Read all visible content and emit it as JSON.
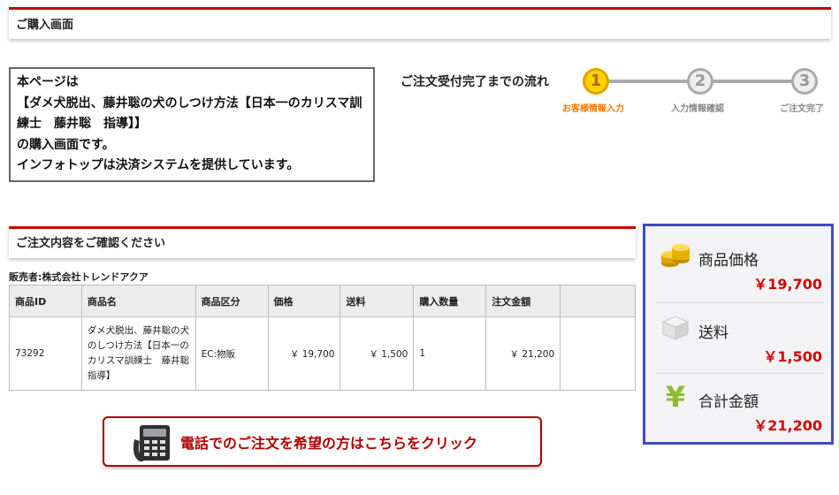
{
  "header": {
    "title": "ご購入画面"
  },
  "intro": {
    "line1": "本ページは",
    "line2": "【ダメ犬脱出、藤井聡の犬のしつけ方法【日本一のカリスマ訓練士　藤井聡　指導】】",
    "line3": "の購入画面です。",
    "line4": "インフォトップは決済システムを提供しています。"
  },
  "flow": {
    "title": "ご注文受付完了までの流れ",
    "steps": [
      {
        "number": "1",
        "label": "お客様情報入力",
        "state": "active"
      },
      {
        "number": "2",
        "label": "入力情報確認",
        "state": "inactive"
      },
      {
        "number": "3",
        "label": "ご注文完了",
        "state": "inactive"
      }
    ]
  },
  "order": {
    "title": "ご注文内容をご確認ください",
    "seller": "販売者:株式会社トレンドアクア",
    "columns": [
      "商品ID",
      "商品名",
      "商品区分",
      "価格",
      "送料",
      "購入数量",
      "注文金額"
    ],
    "row": {
      "id": "73292",
      "name": "ダメ犬脱出、藤井聡の犬のしつけ方法【日本一のカリスマ訓練士　藤井聡　指導】",
      "category": "EC:物販",
      "price": "￥ 19,700",
      "shipping": "￥ 1,500",
      "quantity": "1",
      "total": "￥ 21,200"
    }
  },
  "phone_button": {
    "label": "電話でのご注文を希望の方はこちらをクリック"
  },
  "summary": {
    "price_label": "商品価格",
    "price_value": "￥19,700",
    "shipping_label": "送料",
    "shipping_value": "￥1,500",
    "total_label": "合計金額",
    "total_value": "￥21,200"
  },
  "colors": {
    "accent_red": "#c40000",
    "summary_border": "#3d4bc4",
    "active_step": "#ffd400",
    "active_step_label": "#ff7a00"
  },
  "icons": {
    "price": "coin-stack-icon",
    "shipping": "box-icon",
    "total": "yen-icon",
    "phone": "telephone-icon"
  }
}
